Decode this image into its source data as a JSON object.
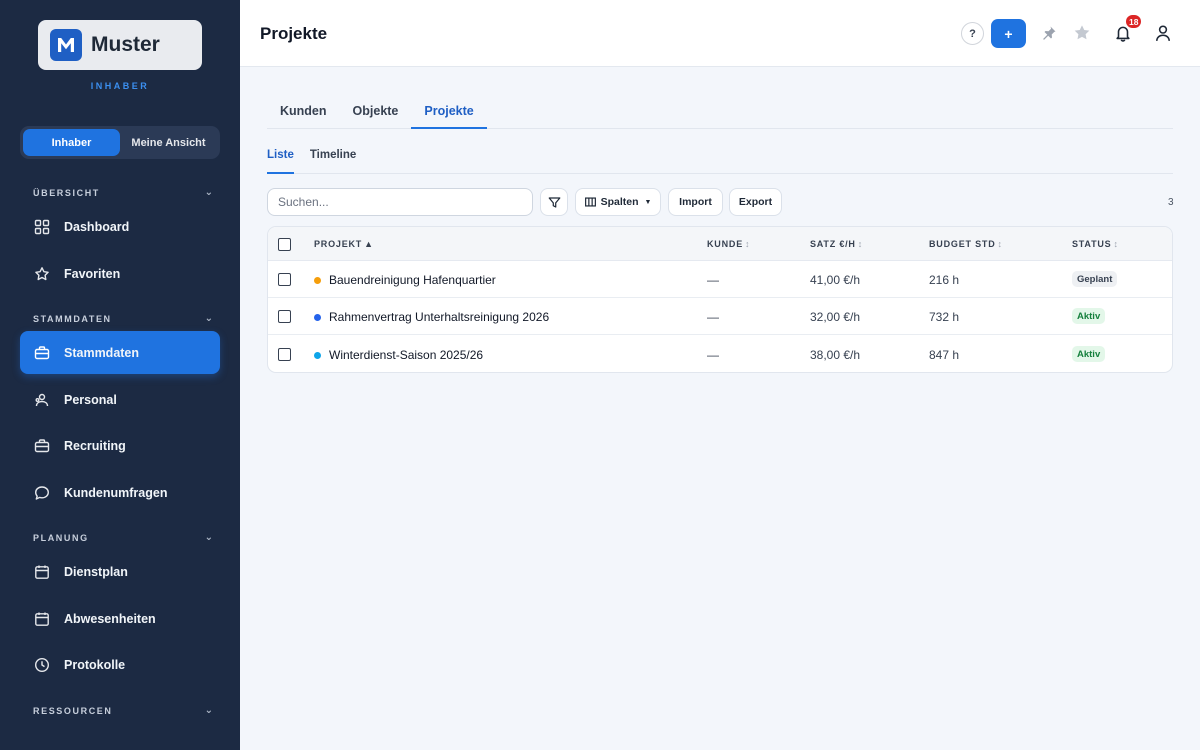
{
  "brand": {
    "name": "Muster",
    "role": "INHABER",
    "mark": "M"
  },
  "view_toggle": {
    "owner": "Inhaber",
    "mine": "Meine Ansicht"
  },
  "sidebar": {
    "sections": [
      {
        "title": "ÜBERSICHT"
      },
      {
        "title": "STAMMDATEN"
      },
      {
        "title": "PLANUNG"
      },
      {
        "title": "RESSOURCEN"
      }
    ],
    "items": [
      {
        "label": "Dashboard",
        "icon": "grid-icon"
      },
      {
        "label": "Favoriten",
        "icon": "star-icon"
      },
      {
        "label": "Stammdaten",
        "icon": "briefcase-icon",
        "active": true
      },
      {
        "label": "Personal",
        "icon": "people-icon"
      },
      {
        "label": "Recruiting",
        "icon": "briefcase-icon"
      },
      {
        "label": "Kundenumfragen",
        "icon": "chat-icon"
      },
      {
        "label": "Dienstplan",
        "icon": "calendar-icon"
      },
      {
        "label": "Abwesenheiten",
        "icon": "calendar-icon"
      },
      {
        "label": "Protokolle",
        "icon": "clock-icon"
      }
    ]
  },
  "header": {
    "title": "Projekte",
    "help": "?",
    "add": "+",
    "notifications_count": "18"
  },
  "tabs": [
    "Kunden",
    "Objekte",
    "Projekte"
  ],
  "subtabs": [
    "Liste",
    "Timeline"
  ],
  "toolbar": {
    "search_placeholder": "Suchen...",
    "columns_label": "Spalten",
    "import_label": "Import",
    "export_label": "Export",
    "count": "3"
  },
  "table": {
    "headers": {
      "project": "PROJEKT",
      "client": "KUNDE",
      "rate": "SATZ €/H",
      "budget": "BUDGET STD",
      "status": "STATUS"
    },
    "sort_asc": "▲",
    "sort_none": "↕",
    "rows": [
      {
        "name": "Bauendreinigung Hafenquartier",
        "dot": "#f59e0b",
        "client": "—",
        "rate": "41,00 €/h",
        "budget": "216 h",
        "status": "Geplant",
        "status_kind": "planned"
      },
      {
        "name": "Rahmenvertrag Unterhaltsreinigung 2026",
        "dot": "#2563eb",
        "client": "—",
        "rate": "32,00 €/h",
        "budget": "732 h",
        "status": "Aktiv",
        "status_kind": "active"
      },
      {
        "name": "Winterdienst-Saison 2025/26",
        "dot": "#0ea5e9",
        "client": "—",
        "rate": "38,00 €/h",
        "budget": "847 h",
        "status": "Aktiv",
        "status_kind": "active"
      }
    ]
  },
  "colors": {
    "accent": "#1f73e0",
    "sidebar_bg": "#1c2a43",
    "status_planned_bg": "#eef0f3",
    "status_planned_fg": "#374151",
    "status_active_bg": "#e3f7e9",
    "status_active_fg": "#15803d"
  }
}
